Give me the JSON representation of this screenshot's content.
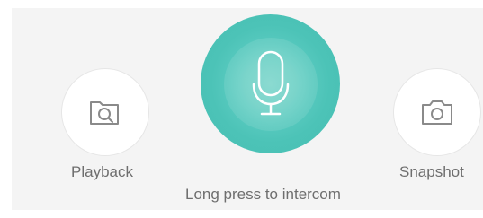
{
  "controls": {
    "playback": {
      "label": "Playback",
      "icon": "folder-search-icon"
    },
    "intercom": {
      "label": "Long press to intercom",
      "icon": "microphone-icon",
      "accent_color": "#4cc3b7"
    },
    "snapshot": {
      "label": "Snapshot",
      "icon": "camera-icon"
    }
  }
}
